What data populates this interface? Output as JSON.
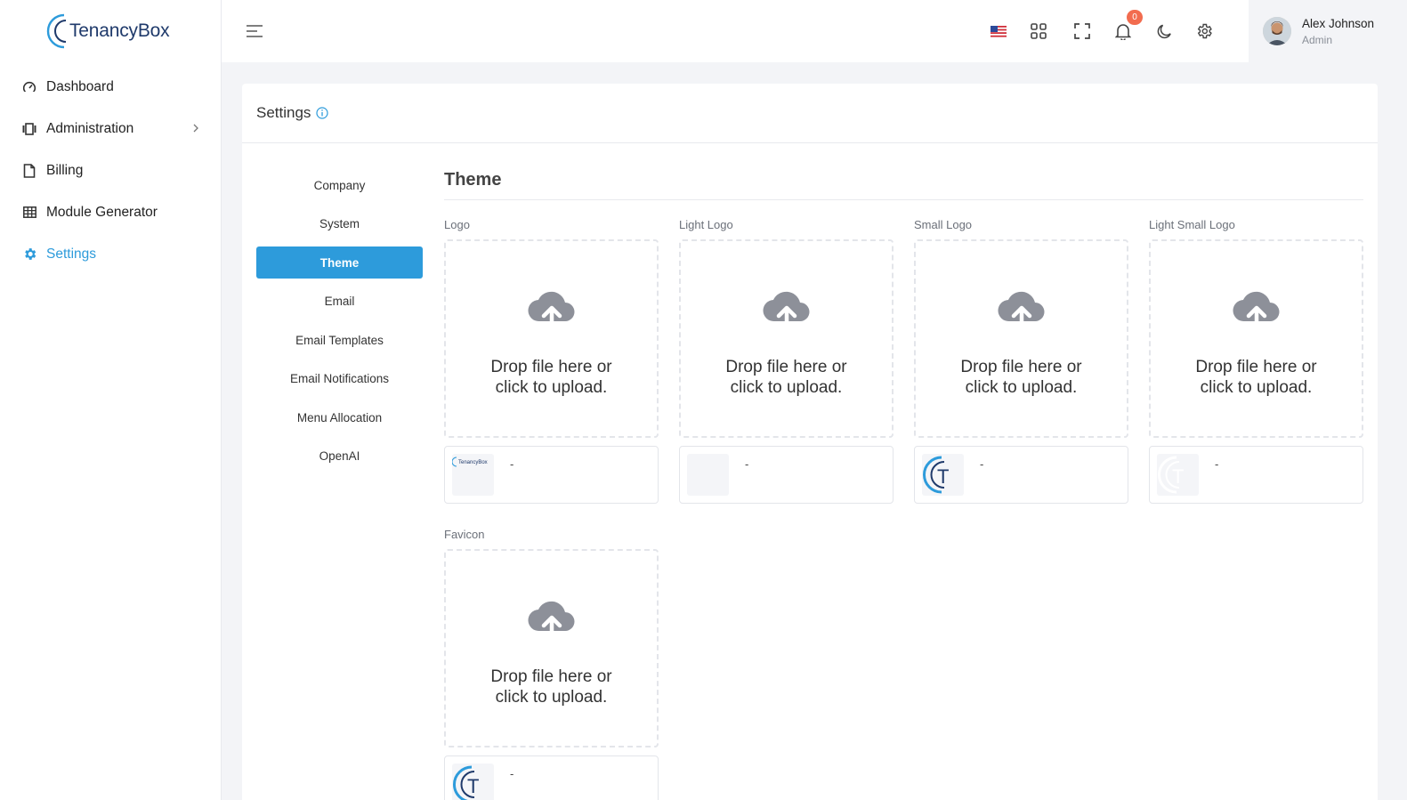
{
  "brand": {
    "name": "TenancyBox"
  },
  "sidebar": {
    "items": [
      {
        "label": "Dashboard",
        "icon": "speedometer-icon"
      },
      {
        "label": "Administration",
        "icon": "admin-icon"
      },
      {
        "label": "Billing",
        "icon": "file-icon"
      },
      {
        "label": "Module Generator",
        "icon": "grid-icon"
      },
      {
        "label": "Settings",
        "icon": "gear-icon"
      }
    ]
  },
  "topbar": {
    "notifications_count": "0",
    "user": {
      "name": "Alex Johnson",
      "role": "Admin"
    }
  },
  "page": {
    "title": "Settings"
  },
  "tabs": [
    "Company",
    "System",
    "Theme",
    "Email",
    "Email Templates",
    "Email Notifications",
    "Menu Allocation",
    "OpenAI"
  ],
  "active_tab": "Theme",
  "theme": {
    "title": "Theme",
    "dropzone_text_1": "Drop file here or",
    "dropzone_text_2": "click to upload.",
    "fields": [
      {
        "label": "Logo",
        "file": "-"
      },
      {
        "label": "Light Logo",
        "file": "-"
      },
      {
        "label": "Small Logo",
        "file": "-"
      },
      {
        "label": "Light Small Logo",
        "file": "-"
      },
      {
        "label": "Favicon",
        "file": "-"
      }
    ]
  },
  "colors": {
    "accent": "#2d9bdb",
    "badge": "#f26c4f",
    "background": "#f3f4f7"
  }
}
